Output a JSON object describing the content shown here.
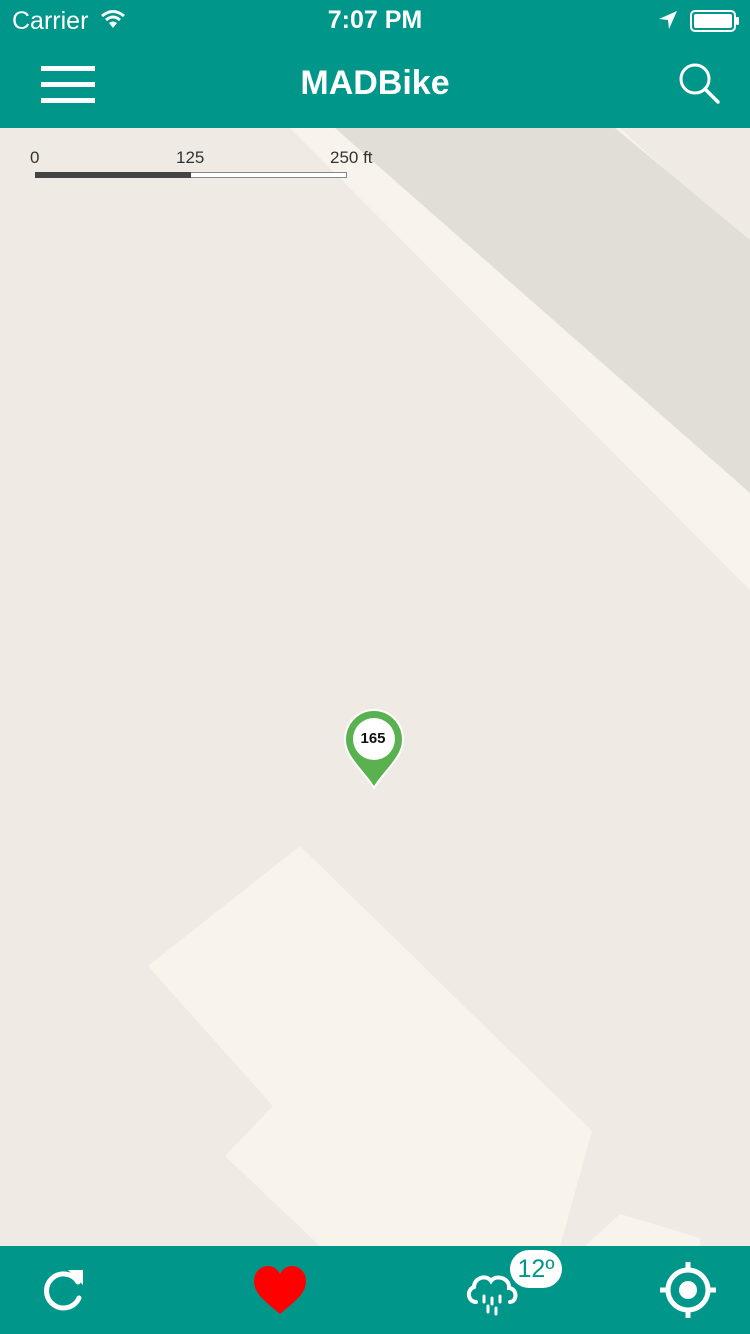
{
  "status_bar": {
    "carrier": "Carrier",
    "time": "7:07 PM"
  },
  "nav": {
    "title": "MADBike",
    "menu_icon": "hamburger-menu-icon",
    "search_icon": "search-icon"
  },
  "map": {
    "scale": {
      "labels": [
        "0",
        "125",
        "250 ft"
      ]
    },
    "station_marker": {
      "count": "165",
      "color": "#5ab14f"
    }
  },
  "bottom_bar": {
    "refresh_icon": "refresh-icon",
    "favorites_icon": "heart-icon",
    "weather_icon": "rain-cloud-icon",
    "weather_temp": "12º",
    "locate_icon": "crosshair-icon"
  },
  "colors": {
    "primary": "#00968a",
    "heart": "#ff0000",
    "map_background": "#efebe4"
  }
}
